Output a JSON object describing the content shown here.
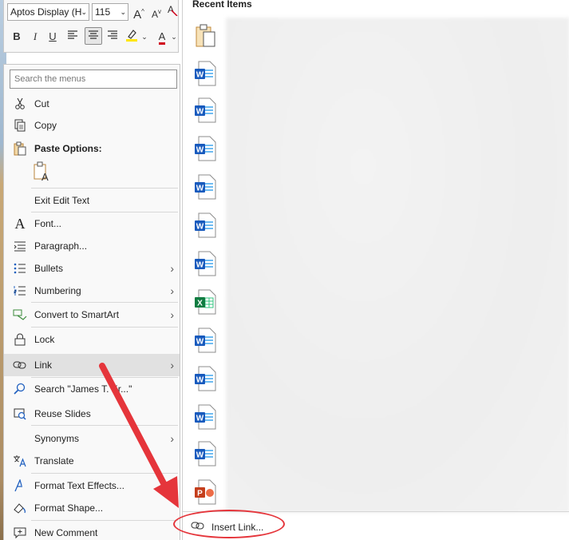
{
  "mini_toolbar": {
    "font_name": "Aptos Display (H",
    "font_size": "115",
    "grow_font": "A",
    "shrink_font": "A",
    "bold": "B",
    "italic": "I",
    "underline": "U",
    "font_color_letter": "A"
  },
  "context_menu": {
    "search_placeholder": "Search the menus",
    "items": {
      "cut": "Cut",
      "copy": "Copy",
      "paste_options": "Paste Options:",
      "exit_edit_text": "Exit Edit Text",
      "font": "Font...",
      "paragraph": "Paragraph...",
      "bullets": "Bullets",
      "numbering": "Numbering",
      "convert_smartart": "Convert to SmartArt",
      "lock": "Lock",
      "link": "Link",
      "search": "Search \"James T. Kr...\"",
      "reuse_slides": "Reuse Slides",
      "synonyms": "Synonyms",
      "translate": "Translate",
      "format_text_effects": "Format Text Effects...",
      "format_shape": "Format Shape...",
      "new_comment": "New Comment"
    },
    "submenu_arrow": "›"
  },
  "recent_panel": {
    "title": "Recent Items",
    "insert_link_label": "Insert Link...",
    "file_icons": [
      "clipboard-icon",
      "word-doc-icon",
      "word-doc-icon",
      "word-doc-icon",
      "word-doc-icon",
      "word-doc-icon",
      "word-doc-icon",
      "excel-doc-icon",
      "word-doc-icon",
      "word-doc-icon",
      "word-doc-icon",
      "word-doc-icon",
      "powerpoint-doc-icon"
    ]
  },
  "colors": {
    "word_blue": "#185abd",
    "excel_green": "#107c41",
    "ppt_red": "#c43e1c",
    "annotation_red": "#e5353b",
    "highlight_yellow": "#ffe600",
    "font_red": "#d0021b"
  }
}
